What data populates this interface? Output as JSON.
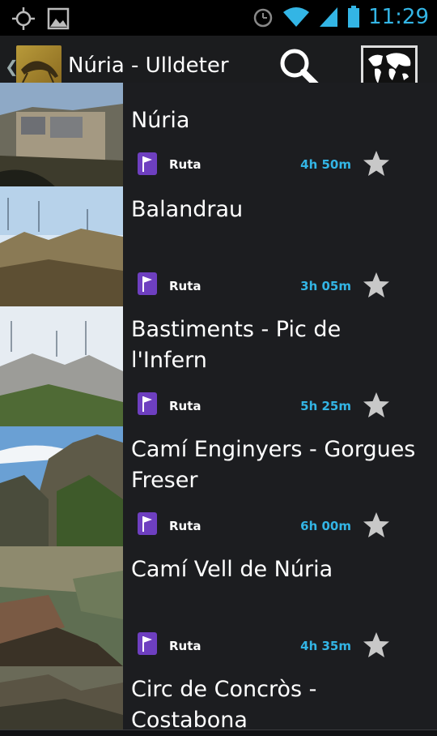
{
  "status_bar": {
    "time": "11:29",
    "icons": [
      "gps-icon",
      "gallery-icon",
      "alarm-icon",
      "wifi-icon",
      "signal-icon",
      "battery-icon"
    ]
  },
  "action_bar": {
    "title": "Núria - Ulldeter",
    "icons": [
      "app-logo",
      "search-icon",
      "map-icon"
    ],
    "accent": "#33b5e5"
  },
  "items": [
    {
      "title": "Núria",
      "type": "Ruta",
      "duration": "4h 50m"
    },
    {
      "title": "Balandrau",
      "type": "Ruta",
      "duration": "3h 05m"
    },
    {
      "title": "Bastiments - Pic de l'Infern",
      "type": "Ruta",
      "duration": "5h 25m"
    },
    {
      "title": "Camí Enginyers - Gorgues Freser",
      "type": "Ruta",
      "duration": "6h 00m"
    },
    {
      "title": "Camí Vell de Núria",
      "type": "Ruta",
      "duration": "4h 35m"
    },
    {
      "title": "Circ de Concròs - Costabona",
      "type": "",
      "duration": ""
    }
  ],
  "colors": {
    "flag": "#6e3fc0",
    "duration": "#33b5e5",
    "star": "#bdbdbd"
  }
}
